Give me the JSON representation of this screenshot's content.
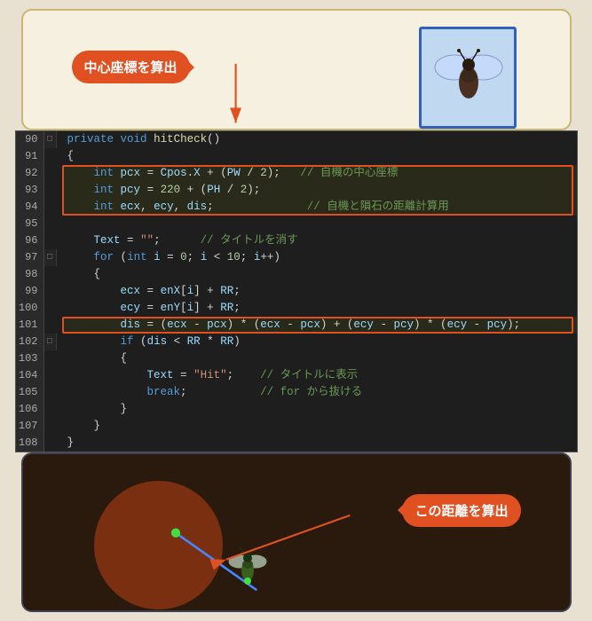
{
  "top_panel": {
    "callout": "中心座標を算出",
    "game_window": {
      "alt": "bee insect game window"
    }
  },
  "code": {
    "lines": [
      {
        "num": 90,
        "fold": "□",
        "yellow": true,
        "content": "private void hitCheck()",
        "type": "normal"
      },
      {
        "num": 91,
        "fold": "",
        "yellow": false,
        "content": "{",
        "type": "normal"
      },
      {
        "num": 92,
        "fold": "",
        "yellow": false,
        "content": "    int pcx = Cpos.X + (PW / 2);   // 自機の中心座標",
        "type": "highlight-start"
      },
      {
        "num": 93,
        "fold": "",
        "yellow": false,
        "content": "    int pcy = 220 + (PH / 2);",
        "type": "highlight"
      },
      {
        "num": 94,
        "fold": "",
        "yellow": false,
        "content": "    int ecx, ecy, dis;              // 自機と隕石の距離計算用",
        "type": "highlight-end"
      },
      {
        "num": 95,
        "fold": "",
        "yellow": false,
        "content": "",
        "type": "normal"
      },
      {
        "num": 96,
        "fold": "",
        "yellow": false,
        "content": "    Text = \"\";      // タイトルを消す",
        "type": "normal"
      },
      {
        "num": 97,
        "fold": "□",
        "yellow": false,
        "content": "    for (int i = 0; i < 10; i++)",
        "type": "normal"
      },
      {
        "num": 98,
        "fold": "",
        "yellow": false,
        "content": "    {",
        "type": "normal"
      },
      {
        "num": 99,
        "fold": "",
        "yellow": false,
        "content": "        ecx = enX[i] + RR;",
        "type": "normal"
      },
      {
        "num": 100,
        "fold": "",
        "yellow": false,
        "content": "        ecy = enY[i] + RR;",
        "type": "normal"
      },
      {
        "num": 101,
        "fold": "",
        "yellow": true,
        "content": "        dis = (ecx - pcx) * (ecx - pcx) + (ecy - pcy) * (ecy - pcy);",
        "type": "highlight-single"
      },
      {
        "num": 102,
        "fold": "□",
        "yellow": false,
        "content": "        if (dis < RR * RR)",
        "type": "normal"
      },
      {
        "num": 103,
        "fold": "",
        "yellow": false,
        "content": "        {",
        "type": "normal"
      },
      {
        "num": 104,
        "fold": "",
        "yellow": false,
        "content": "            Text = \"Hit\";    // タイトルに表示",
        "type": "normal"
      },
      {
        "num": 105,
        "fold": "",
        "yellow": false,
        "content": "            break;           // for から抜ける",
        "type": "normal"
      },
      {
        "num": 106,
        "fold": "",
        "yellow": false,
        "content": "        }",
        "type": "normal"
      },
      {
        "num": 107,
        "fold": "",
        "yellow": false,
        "content": "    }",
        "type": "normal"
      },
      {
        "num": 108,
        "fold": "",
        "yellow": false,
        "content": "}",
        "type": "normal"
      }
    ]
  },
  "bottom_panel": {
    "callout": "この距離を算出"
  },
  "int_keyword": "int"
}
